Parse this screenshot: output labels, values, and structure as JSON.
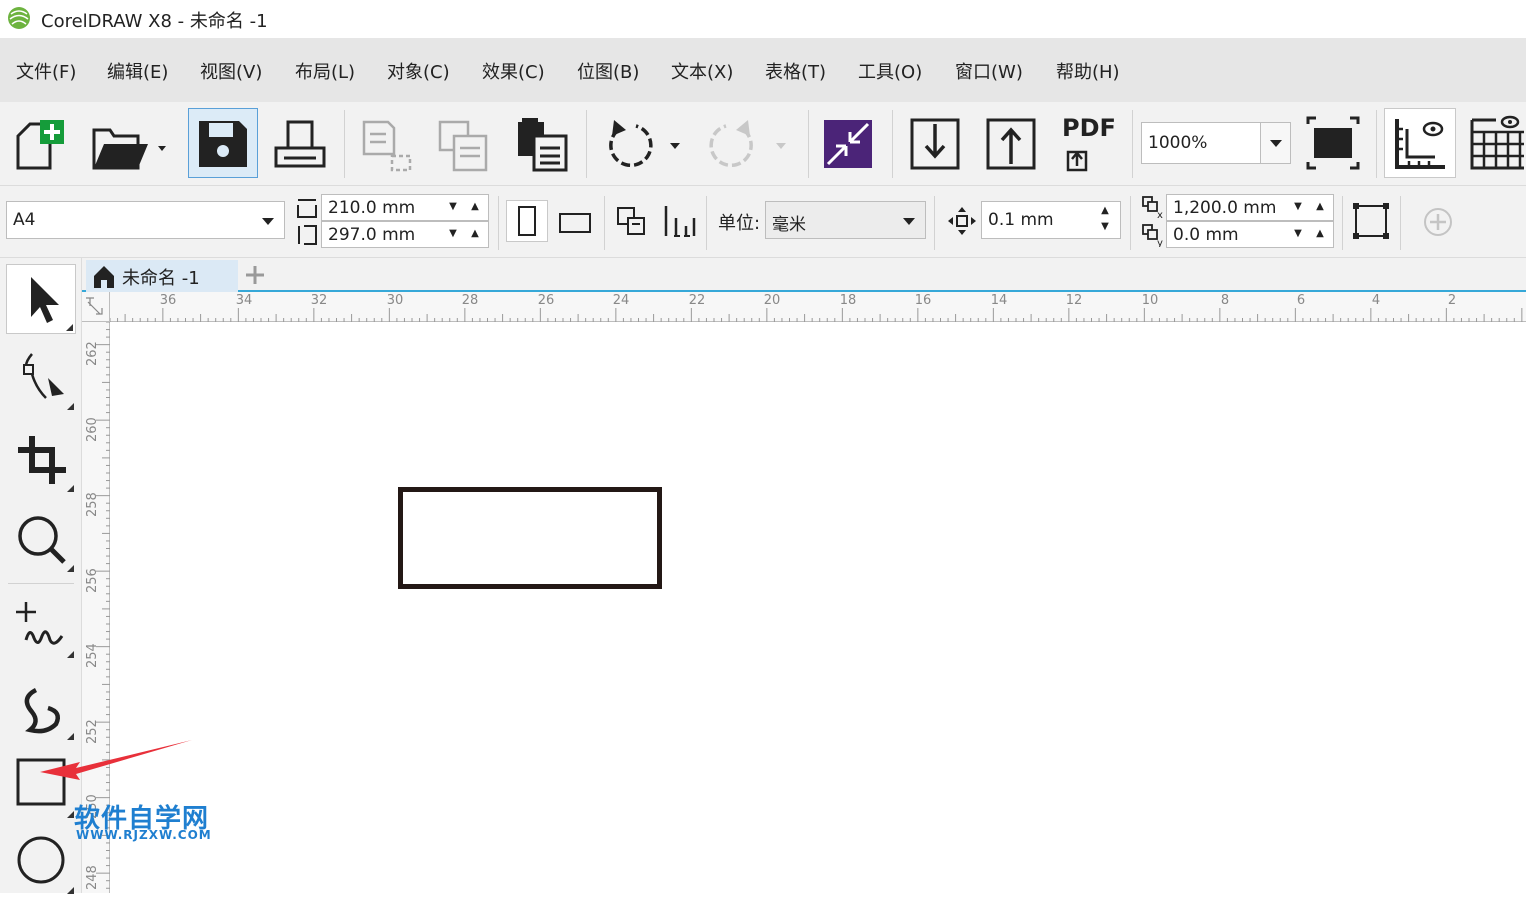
{
  "window": {
    "title": "CorelDRAW X8 - 未命名 -1",
    "logo_icon": "coreldraw-balloon-icon"
  },
  "menu": [
    {
      "label": "文件(F)"
    },
    {
      "label": "编辑(E)"
    },
    {
      "label": "视图(V)"
    },
    {
      "label": "布局(L)"
    },
    {
      "label": "对象(C)"
    },
    {
      "label": "效果(C)"
    },
    {
      "label": "位图(B)"
    },
    {
      "label": "文本(X)"
    },
    {
      "label": "表格(T)"
    },
    {
      "label": "工具(O)"
    },
    {
      "label": "窗口(W)"
    },
    {
      "label": "帮助(H)"
    }
  ],
  "standard_toolbar": {
    "buttons": [
      "new-document-icon",
      "open-icon",
      "save-icon",
      "print-icon",
      "cut-icon",
      "copy-icon",
      "paste-icon",
      "undo-icon",
      "redo-icon",
      "search-content-icon",
      "import-icon",
      "export-icon",
      "pdf-icon",
      "full-screen-icon",
      "show-rulers-icon",
      "show-grid-icon"
    ],
    "pdf_label": "PDF",
    "zoom_value": "1000%"
  },
  "property_bar": {
    "page_size": "A4",
    "page_width": "210.0 mm",
    "page_height": "297.0 mm",
    "units_label": "单位:",
    "units_value": "毫米",
    "nudge_distance": "0.1 mm",
    "dup_x": "1,200.0 mm",
    "dup_y": "0.0 mm"
  },
  "toolbox": {
    "tools": [
      "pick-tool-icon",
      "shape-tool-icon",
      "crop-tool-icon",
      "zoom-tool-icon",
      "freehand-tool-icon",
      "artistic-media-icon",
      "rectangle-tool-icon",
      "ellipse-tool-icon"
    ],
    "active_tool": "pick-tool-icon"
  },
  "document_tabs": [
    {
      "label": "未命名 -1"
    }
  ],
  "rulers": {
    "horizontal": [
      "36",
      "34",
      "32",
      "30",
      "28",
      "26",
      "24",
      "22",
      "20",
      "18",
      "16",
      "14",
      "12",
      "10",
      "8",
      "6",
      "4",
      "2"
    ],
    "vertical": [
      "262",
      "260",
      "258",
      "256",
      "254",
      "252",
      "250",
      "248"
    ]
  },
  "watermark": {
    "main": "软件自学网",
    "url": "WWW.RJZXW.COM"
  },
  "colors": {
    "menu_bg": "#e6e6e6",
    "toolbar_bg": "#f2f2f2",
    "accent_tab": "#36a8d8",
    "annotation_arrow": "#e8303a",
    "watermark": "#1f7fd0",
    "shape_stroke": "#231815"
  }
}
